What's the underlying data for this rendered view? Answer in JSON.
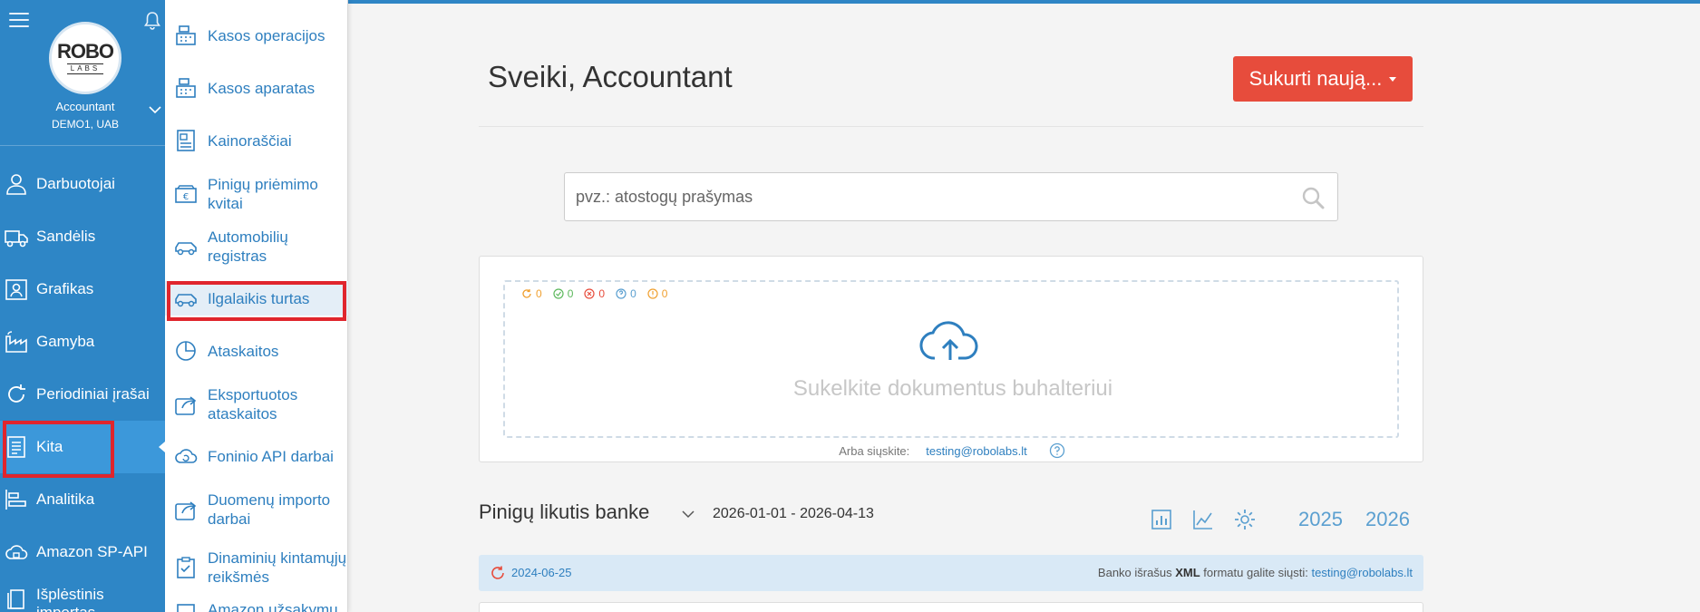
{
  "sidebar": {
    "user_name": "Accountant",
    "company": "DEMO1, UAB",
    "logo_top": "ROBO",
    "logo_bottom": "LABS",
    "items": [
      {
        "label": "Darbuotojai",
        "icon": "person-icon"
      },
      {
        "label": "Sandėlis",
        "icon": "truck-icon"
      },
      {
        "label": "Grafikas",
        "icon": "schedule-icon"
      },
      {
        "label": "Gamyba",
        "icon": "factory-icon"
      },
      {
        "label": "Periodiniai įrašai",
        "icon": "refresh-icon"
      },
      {
        "label": "Kita",
        "icon": "document-icon",
        "active": true
      },
      {
        "label": "Analitika",
        "icon": "analytics-icon"
      },
      {
        "label": "Amazon SP-API",
        "icon": "cloud-lock-icon"
      },
      {
        "label": "Išplėstinis importas",
        "icon": "files-icon"
      }
    ]
  },
  "submenu": {
    "items": [
      {
        "label": "Kasos operacijos",
        "icon": "cash-register-icon"
      },
      {
        "label": "Kasos aparatas",
        "icon": "cash-register-icon"
      },
      {
        "label": "Kainoraščiai",
        "icon": "price-list-icon"
      },
      {
        "label": "Pinigų priėmimo kvitai",
        "icon": "euro-receipt-icon"
      },
      {
        "label": "Automobilių registras",
        "icon": "car-icon"
      },
      {
        "label": "Ilgalaikis turtas",
        "icon": "car-icon",
        "selected": true
      },
      {
        "label": "Ataskaitos",
        "icon": "pie-chart-icon"
      },
      {
        "label": "Eksportuotos ataskaitos",
        "icon": "export-icon"
      },
      {
        "label": "Foninio API darbai",
        "icon": "cloud-sync-icon"
      },
      {
        "label": "Duomenų importo darbai",
        "icon": "import-icon"
      },
      {
        "label": "Dinaminių kintamųjų reikšmės",
        "icon": "clipboard-check-icon"
      },
      {
        "label": "Amazon užsakymu",
        "icon": "amazon-icon"
      }
    ]
  },
  "main": {
    "greeting": "Sveiki, Accountant",
    "create_button": "Sukurti naują...",
    "search_placeholder": "pvz.: atostogų prašymas",
    "upload": {
      "counts": [
        {
          "value": "0",
          "color": "#f0a030",
          "icon": "sync-icon"
        },
        {
          "value": "0",
          "color": "#5cb85c",
          "icon": "check-icon"
        },
        {
          "value": "0",
          "color": "#e74c3c",
          "icon": "error-icon"
        },
        {
          "value": "0",
          "color": "#5a9fd0",
          "icon": "question-icon"
        },
        {
          "value": "0",
          "color": "#f0a030",
          "icon": "warning-icon"
        }
      ],
      "text": "Sukelkite dokumentus buhalteriui",
      "or_send": "Arba siųskite:",
      "email": "testing@robolabs.lt"
    },
    "bank": {
      "title": "Pinigų likutis banke",
      "range": "2026-01-01 - 2026-04-13",
      "years": [
        "2025",
        "2026"
      ],
      "info_date": "2024-06-25",
      "note_prefix": "Banko išrašus",
      "note_format": "XML",
      "note_suffix": "formatu galite siųsti:",
      "note_email": "testing@robolabs.lt"
    }
  },
  "colors": {
    "sidebar": "#2e86c6",
    "accent": "#2e7fbf",
    "create": "#e74c3c",
    "highlight": "#e0252d"
  }
}
